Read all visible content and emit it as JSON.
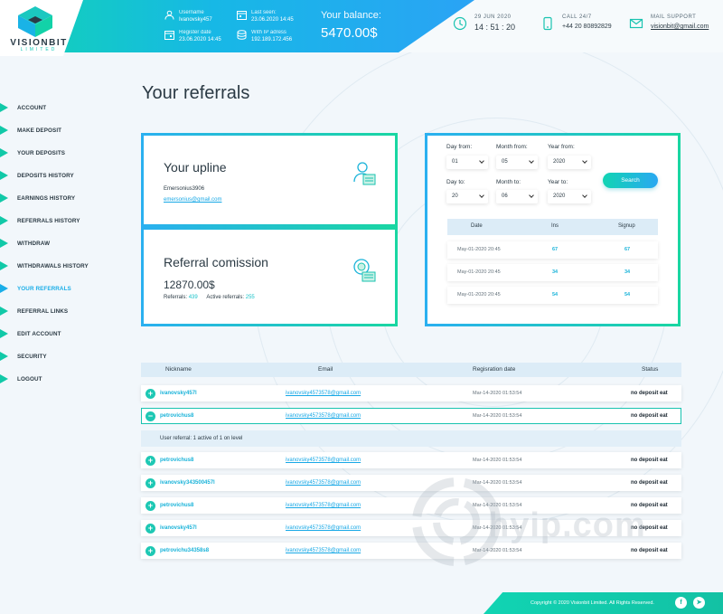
{
  "brand": {
    "name": "VISIONBIT",
    "sub": "LIMITED"
  },
  "header": {
    "username_label": "Username",
    "username": "Ivanovsky457",
    "last_seen_label": "Last seen:",
    "last_seen": "23.06.2020  14:45",
    "register_label": "Register date",
    "register_date": "23.06.2020  14:45",
    "ip_label": "With IP adress",
    "ip": "192.189.172.456",
    "balance_label": "Your balance:",
    "balance": "5470.00$",
    "date": "29 JUN 2020",
    "time": "14 : 51 : 20",
    "call_label": "CALL 24/7",
    "phone": "+44 20 80892829",
    "mail_label": "MAIL SUPPORT",
    "email": "visionbit@gmail.com"
  },
  "nav": {
    "items": [
      {
        "label": "ACCOUNT"
      },
      {
        "label": "MAKE DEPOSIT"
      },
      {
        "label": "YOUR DEPOSITS"
      },
      {
        "label": "DEPOSITS HISTORY"
      },
      {
        "label": "EARNINGS HISTORY"
      },
      {
        "label": "REFERRALS HISTORY"
      },
      {
        "label": "WITHDRAW"
      },
      {
        "label": "WITHDRAWALS HISTORY"
      },
      {
        "label": "YOUR REFERRALS"
      },
      {
        "label": "REFERRAL LINKS"
      },
      {
        "label": "EDIT ACCOUNT"
      },
      {
        "label": "SECURITY"
      },
      {
        "label": "LOGOUT"
      }
    ],
    "active_index": 8
  },
  "page": {
    "title": "Your referrals"
  },
  "upline": {
    "title": "Your upline",
    "name": "Emersonius3906",
    "email": "emersonius@gmail.com"
  },
  "commission": {
    "title": "Referral comission",
    "amount": "12870.00$",
    "referrals_label": "Referrals:",
    "referrals": "439",
    "active_label": "Active referrals:",
    "active": "255"
  },
  "filter": {
    "day_from_label": "Day from:",
    "day_from": "01",
    "month_from_label": "Month from:",
    "month_from": "05",
    "year_from_label": "Year from:",
    "year_from": "2020",
    "day_to_label": "Day to:",
    "day_to": "20",
    "month_to_label": "Month to:",
    "month_to": "06",
    "year_to_label": "Year to:",
    "year_to": "2020",
    "search_label": "Search"
  },
  "stats": {
    "headers": [
      "Date",
      "Ins",
      "Signup"
    ],
    "rows": [
      [
        "May-01-2020  20:45",
        "67",
        "67"
      ],
      [
        "May-01-2020  20:45",
        "34",
        "34"
      ],
      [
        "May-01-2020  20:45",
        "54",
        "54"
      ]
    ]
  },
  "table": {
    "headers": [
      "Nickname",
      "Email",
      "Regisration date",
      "Status"
    ],
    "rows": [
      {
        "toggle": "+",
        "nick": "ivanovsky457l",
        "email": "ivanovsky4573578@gmail.com",
        "date": "Mar-14-2020  01:53:54",
        "status": "no deposit eat"
      },
      {
        "toggle": "−",
        "nick": "petrovichus8",
        "email": "ivanovsky4573578@gmail.com",
        "date": "Mar-14-2020  01:53:54",
        "status": "no deposit eat"
      },
      {
        "toggle": "+",
        "nick": "petrovichus8",
        "email": "ivanovsky4573578@gmail.com",
        "date": "Mar-14-2020  01:53:54",
        "status": "no deposit eat"
      },
      {
        "toggle": "+",
        "nick": "ivanovsky343500457l",
        "email": "ivanovsky4573578@gmail.com",
        "date": "Mar-14-2020  01:53:54",
        "status": "no deposit eat"
      },
      {
        "toggle": "+",
        "nick": "petrovichus8",
        "email": "ivanovsky4573578@gmail.com",
        "date": "Mar-14-2020  01:53:54",
        "status": "no deposit eat"
      },
      {
        "toggle": "+",
        "nick": "ivanovsky457l",
        "email": "ivanovsky4573578@gmail.com",
        "date": "Mar-14-2020  01:53:54",
        "status": "no deposit eat"
      },
      {
        "toggle": "+",
        "nick": "petrovichu34358s8",
        "email": "ivanovsky4573578@gmail.com",
        "date": "Mar-14-2020  01:53:54",
        "status": "no deposit eat"
      }
    ],
    "subrow": "User referral: 1 active of 1 on level"
  },
  "footer": {
    "copyright": "Copyright © 2020 Visionbit Limited. All Rights Reserved.",
    "fb": "f",
    "tg": "➤"
  },
  "watermark": "hyip.com",
  "colors": {
    "accent_teal": "#11d4b3",
    "accent_blue": "#2aa3f5",
    "active_nav": "#1aaee8"
  }
}
